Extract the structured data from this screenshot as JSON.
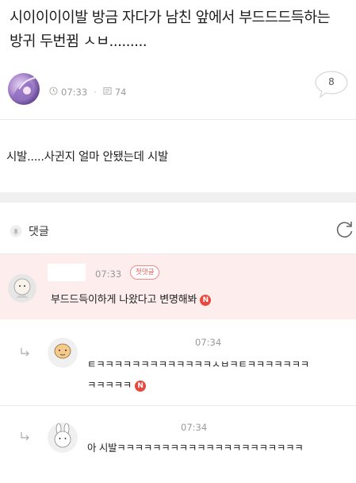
{
  "post": {
    "title": "시이이이이발 방금 자다가 남친 앞에서 부드드드득하는 방귀 두번뀜 ㅅㅂ.........",
    "time": "07:33",
    "views": "74",
    "comment_count": "8",
    "body": "시발.....사귄지 얼마 안됐는데 시발"
  },
  "comments_header": {
    "label": "댓글"
  },
  "comments": [
    {
      "time": "07:33",
      "badge": "첫댓글",
      "text": "부드드득이하게 나왔다고 변명해봐",
      "new_badge": "N"
    }
  ],
  "replies": [
    {
      "time": "07:34",
      "line1": "ㅌㅋㅋㅋㅋㅋㅋㅋㅋㅋㅋㅋㅋㅋㅅㅂㅋㅌㅋㅋㅋㅋㅋㅋㅋ",
      "line2": "ㅋㅋㅋㅋㅋ",
      "new_badge": "N"
    },
    {
      "time": "07:34",
      "text": "아 시발ㅋㅋㅋㅋㅋㅋㅋㅋㅋㅋㅋㅋㅋㅋㅋㅋㅋㅋㅋㅋㅋ"
    }
  ],
  "icons": {
    "clock": "clock-icon",
    "views": "view-count-icon",
    "comment": "comment-bubble-icon",
    "bell": "bell-icon",
    "refresh": "refresh-icon",
    "reply": "reply-arrow-icon"
  },
  "colors": {
    "highlight_bg": "#fdeeed",
    "badge_red": "#e8493f",
    "first_badge": "#e4605b"
  }
}
